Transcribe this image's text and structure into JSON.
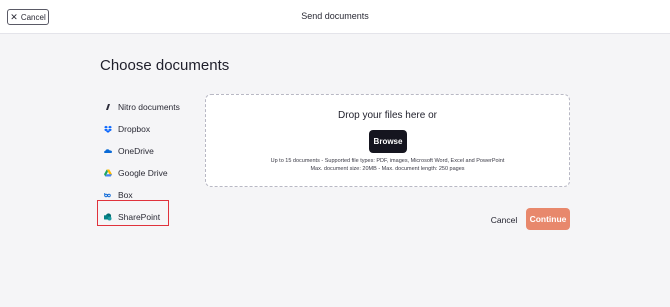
{
  "header": {
    "cancel_label": "Cancel",
    "title": "Send documents"
  },
  "main": {
    "heading": "Choose documents",
    "sources": [
      {
        "label": "Nitro documents",
        "icon": "nitro-icon",
        "color": "#2c2c3a"
      },
      {
        "label": "Dropbox",
        "icon": "dropbox-icon",
        "color": "#0061fe"
      },
      {
        "label": "OneDrive",
        "icon": "onedrive-icon",
        "color": "#0a6ad6"
      },
      {
        "label": "Google Drive",
        "icon": "google-drive-icon",
        "color": "#1fa463"
      },
      {
        "label": "Box",
        "icon": "box-icon",
        "color": "#0061d5"
      },
      {
        "label": "SharePoint",
        "icon": "sharepoint-icon",
        "color": "#038387"
      }
    ],
    "dropzone": {
      "title": "Drop your files here or",
      "browse_label": "Browse",
      "note_line1": "Up to 15 documents - Supported file types: PDF, images, Microsoft Word, Excel and PowerPoint",
      "note_line2": "Max. document size: 20MB - Max. document length: 250 pages"
    },
    "actions": {
      "cancel_label": "Cancel",
      "continue_label": "Continue"
    }
  },
  "colors": {
    "accent": "#e8886c",
    "highlight": "#e0323c"
  }
}
